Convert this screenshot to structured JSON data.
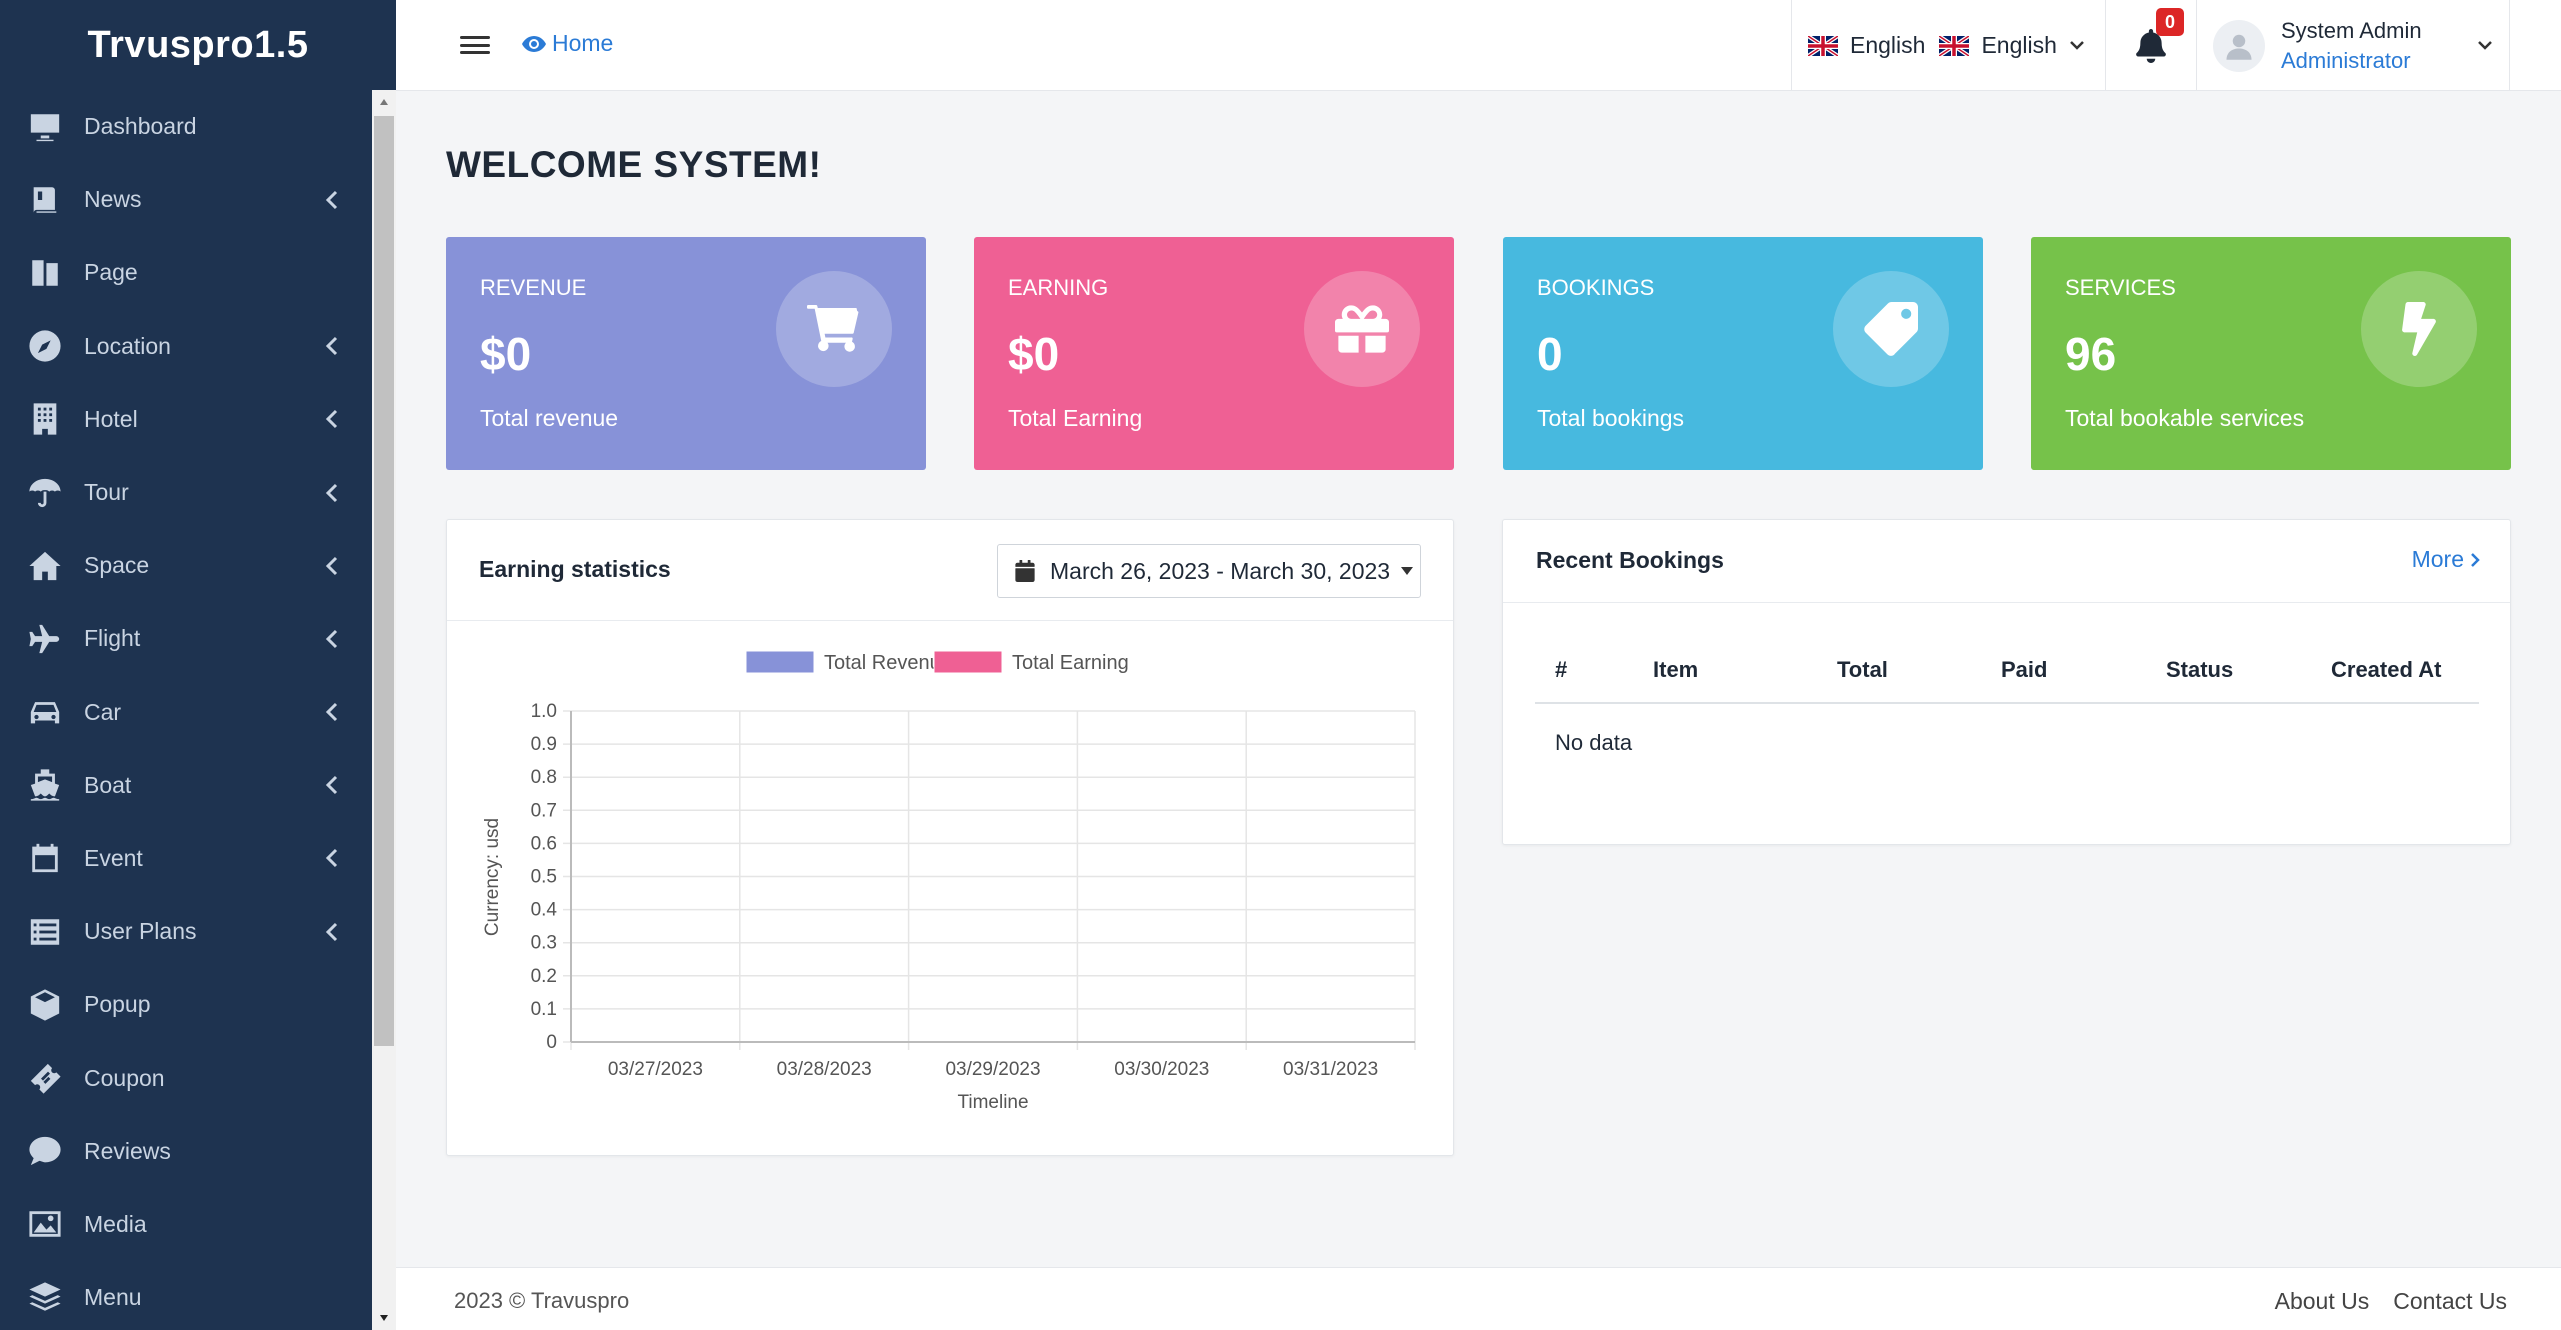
{
  "brand": "Trvuspro1.5",
  "sidebar": {
    "items": [
      {
        "label": "Dashboard",
        "icon": "monitor-icon",
        "has_children": false
      },
      {
        "label": "News",
        "icon": "book-icon",
        "has_children": true
      },
      {
        "label": "Page",
        "icon": "pages-icon",
        "has_children": false
      },
      {
        "label": "Location",
        "icon": "compass-icon",
        "has_children": true
      },
      {
        "label": "Hotel",
        "icon": "building-icon",
        "has_children": true
      },
      {
        "label": "Tour",
        "icon": "umbrella-icon",
        "has_children": true
      },
      {
        "label": "Space",
        "icon": "home-icon",
        "has_children": true
      },
      {
        "label": "Flight",
        "icon": "plane-icon",
        "has_children": true
      },
      {
        "label": "Car",
        "icon": "car-icon",
        "has_children": true
      },
      {
        "label": "Boat",
        "icon": "ship-icon",
        "has_children": true
      },
      {
        "label": "Event",
        "icon": "calendar-icon",
        "has_children": true
      },
      {
        "label": "User Plans",
        "icon": "list-icon",
        "has_children": true
      },
      {
        "label": "Popup",
        "icon": "box-icon",
        "has_children": false
      },
      {
        "label": "Coupon",
        "icon": "ticket-icon",
        "has_children": false
      },
      {
        "label": "Reviews",
        "icon": "comment-icon",
        "has_children": false
      },
      {
        "label": "Media",
        "icon": "image-icon",
        "has_children": false
      },
      {
        "label": "Menu",
        "icon": "layers-icon",
        "has_children": false
      }
    ]
  },
  "header": {
    "home_label": "Home",
    "lang_current": "English",
    "lang_select": "English",
    "notifications_count": "0",
    "user_name": "System Admin",
    "user_role": "Administrator"
  },
  "main": {
    "welcome": "WELCOME SYSTEM!",
    "stats": [
      {
        "title": "REVENUE",
        "value": "$0",
        "sub": "Total revenue",
        "color": "#8792d8",
        "icon": "cart-icon"
      },
      {
        "title": "EARNING",
        "value": "$0",
        "sub": "Total Earning",
        "color": "#ef6094",
        "icon": "gift-icon"
      },
      {
        "title": "BOOKINGS",
        "value": "0",
        "sub": "Total bookings",
        "color": "#47b9df",
        "icon": "tag-icon"
      },
      {
        "title": "SERVICES",
        "value": "96",
        "sub": "Total bookable services",
        "color": "#76c24a",
        "icon": "bolt-icon"
      }
    ],
    "earning_stats": {
      "title": "Earning statistics",
      "date_range": "March 26, 2023 - March 30, 2023"
    },
    "recent_bookings": {
      "title": "Recent Bookings",
      "more_label": "More",
      "columns": [
        "#",
        "Item",
        "Total",
        "Paid",
        "Status",
        "Created At"
      ],
      "empty_text": "No data"
    }
  },
  "chart_data": {
    "type": "bar",
    "categories": [
      "03/27/2023",
      "03/28/2023",
      "03/29/2023",
      "03/30/2023",
      "03/31/2023"
    ],
    "series": [
      {
        "name": "Total Revenue",
        "values": [
          0,
          0,
          0,
          0,
          0
        ],
        "color": "#8792d8"
      },
      {
        "name": "Total Earning",
        "values": [
          0,
          0,
          0,
          0,
          0
        ],
        "color": "#ef6094"
      }
    ],
    "xlabel": "Timeline",
    "ylabel": "Currency: usd",
    "ylim": [
      0,
      1.0
    ],
    "yticks": [
      "1.0",
      "0.9",
      "0.8",
      "0.7",
      "0.6",
      "0.5",
      "0.4",
      "0.3",
      "0.2",
      "0.1",
      "0"
    ],
    "legend": "top",
    "grid": true
  },
  "footer": {
    "copyright": "2023 © Travuspro",
    "links": [
      "About Us",
      "Contact Us"
    ]
  }
}
